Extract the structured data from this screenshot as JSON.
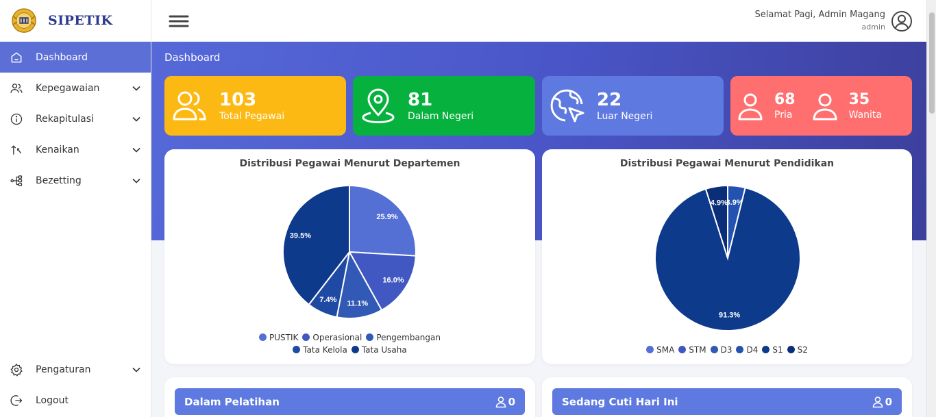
{
  "brand": {
    "name": "SIPETIK"
  },
  "sidebar": {
    "items": [
      {
        "label": "Dashboard",
        "icon": "home-icon"
      },
      {
        "label": "Kepegawaian",
        "icon": "users-icon"
      },
      {
        "label": "Rekapitulasi",
        "icon": "info-icon"
      },
      {
        "label": "Kenaikan",
        "icon": "arrows-up-down-icon"
      },
      {
        "label": "Bezetting",
        "icon": "hierarchy-icon"
      }
    ],
    "bottom": [
      {
        "label": "Pengaturan",
        "icon": "gear-icon"
      },
      {
        "label": "Logout",
        "icon": "logout-icon"
      }
    ]
  },
  "header": {
    "greeting": "Selamat Pagi, Admin Magang",
    "role": "admin"
  },
  "page": {
    "title": "Dashboard"
  },
  "stats": {
    "total": {
      "value": "103",
      "label": "Total Pegawai"
    },
    "domestic": {
      "value": "81",
      "label": "Dalam Negeri"
    },
    "abroad": {
      "value": "22",
      "label": "Luar Negeri"
    },
    "male": {
      "value": "68",
      "label": "Pria"
    },
    "female": {
      "value": "35",
      "label": "Wanita"
    }
  },
  "colors": {
    "accent": "#5b6fd6",
    "yellow": "#fdb913",
    "green": "#06b13e",
    "blue": "#5e79e0",
    "red": "#ff6f6f"
  },
  "chart_data": [
    {
      "type": "pie",
      "title": "Distribusi Pegawai Menurut Departemen",
      "categories": [
        "PUSTIK",
        "Operasional",
        "Pengembangan",
        "Tata Kelola",
        "Tata Usaha"
      ],
      "values": [
        25.9,
        16.0,
        11.1,
        7.4,
        39.5
      ],
      "labels": [
        "25.9%",
        "16.0%",
        "11.1%",
        "7.4%",
        "39.5%"
      ],
      "colors": [
        "#5470d4",
        "#4158c2",
        "#3159b5",
        "#1f4aa3",
        "#0e3a8c"
      ],
      "legend": "bottom"
    },
    {
      "type": "pie",
      "title": "Distribusi Pegawai Menurut Pendidikan",
      "categories": [
        "SMA",
        "STM",
        "D3",
        "D4",
        "S1",
        "S2"
      ],
      "values": [
        0,
        0,
        0,
        3.9,
        91.3,
        4.9
      ],
      "labels": [
        "",
        "",
        "",
        "3.9%",
        "91.3%",
        "4.9%"
      ],
      "colors": [
        "#5470d4",
        "#4158c2",
        "#3159b5",
        "#2352b0",
        "#0e3a8c",
        "#0a2f78"
      ],
      "legend": "bottom"
    }
  ],
  "panels": {
    "training": {
      "title": "Dalam Pelatihan",
      "count": "0"
    },
    "leave": {
      "title": "Sedang Cuti Hari Ini",
      "count": "0"
    }
  }
}
